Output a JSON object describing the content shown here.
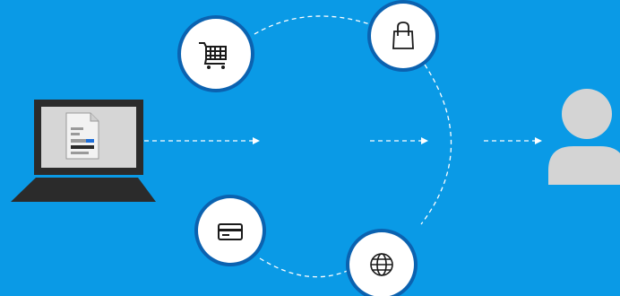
{
  "diagram": {
    "colors": {
      "background": "#0a9ae6",
      "circle_fill": "#ffffff",
      "circle_border": "#0b62b0",
      "icon": "#1a1a1a",
      "dashed_line": "#ffffff",
      "laptop_body": "#2b2b2b",
      "laptop_screen": "#d6d6d6",
      "document_accent": "#1e6fd9",
      "person": "#d4d4d4"
    },
    "nodes": [
      {
        "name": "shopping-cart-icon"
      },
      {
        "name": "shopping-bag-icon"
      },
      {
        "name": "credit-card-icon"
      },
      {
        "name": "globe-icon"
      }
    ],
    "source": {
      "icon": "laptop-with-document-icon"
    },
    "target": {
      "icon": "person-icon"
    },
    "flow_arrows": 3
  }
}
